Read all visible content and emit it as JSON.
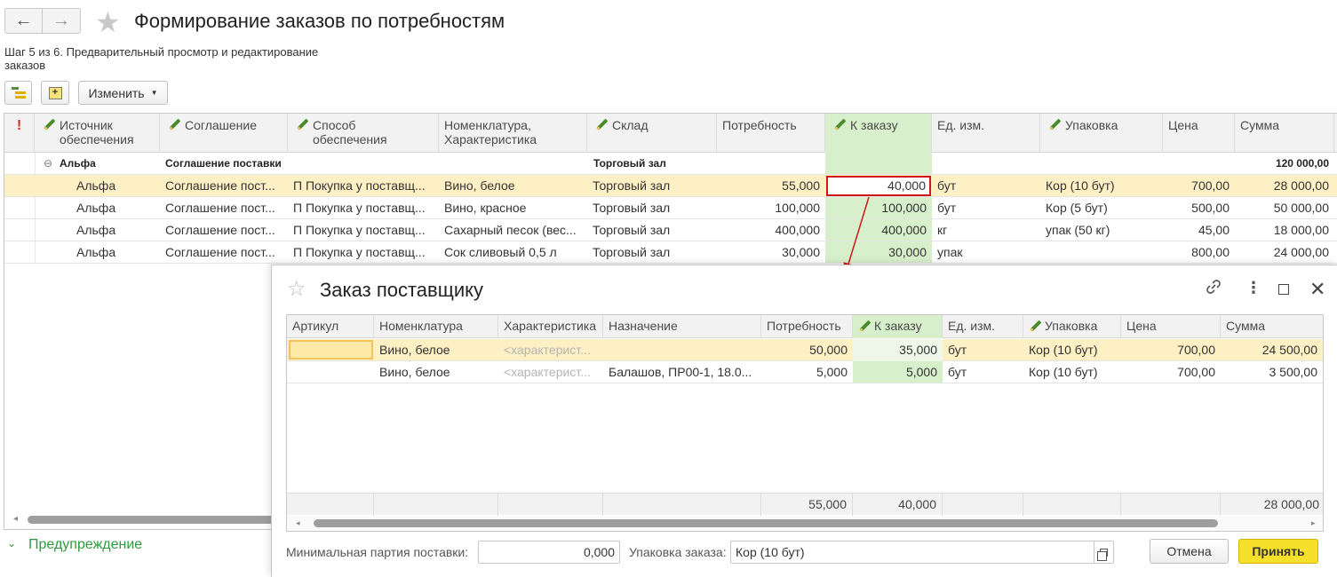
{
  "page": {
    "title": "Формирование заказов по потребностям",
    "back_icon": "←",
    "forward_icon": "→",
    "star_icon": "★",
    "step_text": "Шаг 5 из 6. Предварительный просмотр и редактирование заказов"
  },
  "toolbar": {
    "change_label": "Изменить"
  },
  "grid": {
    "headers": {
      "flag": "!",
      "source": "Источник обеспечения",
      "agreement": "Соглашение",
      "method": "Способ обеспечения",
      "nomenclature": "Номенклатура, Характеристика",
      "warehouse": "Склад",
      "need": "Потребность",
      "to_order": "К заказу",
      "unit": "Ед. изм.",
      "package": "Упаковка",
      "price": "Цена",
      "sum": "Сумма"
    },
    "group": {
      "toggle": "⊖",
      "source": "Альфа",
      "agreement": "Соглашение поставки",
      "warehouse": "Торговый зал",
      "sum": "120 000,00"
    },
    "rows": [
      {
        "source": "Альфа",
        "agreement": "Соглашение пост...",
        "method": "П Покупка у поставщ...",
        "nomenclature": "Вино, белое",
        "warehouse": "Торговый зал",
        "need": "55,000",
        "to_order": "40,000",
        "unit": "бут",
        "package": "Кор (10 бут)",
        "price": "700,00",
        "sum": "28 000,00"
      },
      {
        "source": "Альфа",
        "agreement": "Соглашение пост...",
        "method": "П Покупка у поставщ...",
        "nomenclature": "Вино, красное",
        "warehouse": "Торговый зал",
        "need": "100,000",
        "to_order": "100,000",
        "unit": "бут",
        "package": "Кор (5 бут)",
        "price": "500,00",
        "sum": "50 000,00"
      },
      {
        "source": "Альфа",
        "agreement": "Соглашение пост...",
        "method": "П Покупка у поставщ...",
        "nomenclature": "Сахарный песок (вес...",
        "warehouse": "Торговый зал",
        "need": "400,000",
        "to_order": "400,000",
        "unit": "кг",
        "package": "упак (50 кг)",
        "price": "45,00",
        "sum": "18 000,00"
      },
      {
        "source": "Альфа",
        "agreement": "Соглашение пост...",
        "method": "П Покупка у поставщ...",
        "nomenclature": "Сок сливовый 0,5 л",
        "warehouse": "Торговый зал",
        "need": "30,000",
        "to_order": "30,000",
        "unit": "упак",
        "package": "",
        "price": "800,00",
        "sum": "24 000,00"
      }
    ]
  },
  "warning": {
    "caret": "⌄",
    "label": "Предупреждение"
  },
  "dialog": {
    "title": "Заказ поставщику",
    "star_icon": "☆",
    "more_icon": "⋮",
    "close_icon": "✕",
    "headers": {
      "article": "Артикул",
      "nomenclature": "Номенклатура",
      "characteristic": "Характеристика",
      "purpose": "Назначение",
      "need": "Потребность",
      "to_order": "К заказу",
      "unit": "Ед. изм.",
      "package": "Упаковка",
      "price": "Цена",
      "sum": "Сумма"
    },
    "rows": [
      {
        "article": "",
        "nomenclature": "Вино, белое",
        "characteristic": "<характерист...",
        "purpose": "",
        "need": "50,000",
        "to_order": "35,000",
        "unit": "бут",
        "package": "Кор (10 бут)",
        "price": "700,00",
        "sum": "24 500,00"
      },
      {
        "article": "",
        "nomenclature": "Вино, белое",
        "characteristic": "<характерист...",
        "purpose": "Балашов, ПР00-1, 18.0...",
        "need": "5,000",
        "to_order": "5,000",
        "unit": "бут",
        "package": "Кор (10 бут)",
        "price": "700,00",
        "sum": "3 500,00"
      }
    ],
    "totals": {
      "need": "55,000",
      "to_order": "40,000",
      "sum": "28 000,00"
    },
    "min_batch_label": "Минимальная партия поставки:",
    "min_batch_value": "0,000",
    "package_label": "Упаковка заказа:",
    "package_value": "Кор (10 бут)",
    "cancel_label": "Отмена",
    "accept_label": "Принять"
  },
  "colors": {
    "editable_column": "#d7efcb",
    "selected_row": "#fcf0c4",
    "highlight_box": "#d01818",
    "accept_button": "#f7df2a",
    "warning_text": "#2e9a3c"
  }
}
